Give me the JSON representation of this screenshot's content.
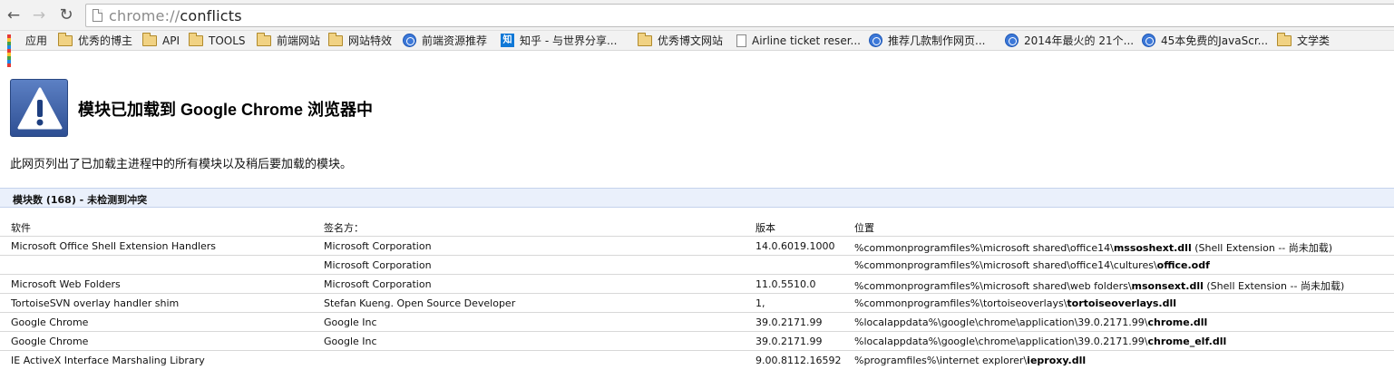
{
  "toolbar": {
    "back_glyph": "←",
    "forward_glyph": "→",
    "reload_glyph": "↻",
    "url_scheme": "chrome://",
    "url_host": "conflicts"
  },
  "bookmarks": [
    {
      "label": "应用",
      "icon": "apps-icon"
    },
    {
      "label": "优秀的博主",
      "icon": "folder-icon"
    },
    {
      "label": "API",
      "icon": "folder-icon"
    },
    {
      "label": "TOOLS",
      "icon": "folder-icon"
    },
    {
      "label": "前端网站",
      "icon": "folder-icon"
    },
    {
      "label": "网站特效",
      "icon": "folder-icon"
    },
    {
      "label": "前端资源推荐",
      "icon": "globe-icon"
    },
    {
      "label": "知乎 - 与世界分享...",
      "icon": "zhihu-icon",
      "glyph": "知"
    },
    {
      "label": "优秀博文网站",
      "icon": "folder-icon"
    },
    {
      "label": "Airline ticket reser...",
      "icon": "document-icon"
    },
    {
      "label": "推荐几款制作网页...",
      "icon": "globe-icon"
    },
    {
      "label": "2014年最火的 21个...",
      "icon": "globe-icon"
    },
    {
      "label": "45本免费的JavaScr...",
      "icon": "globe-icon"
    },
    {
      "label": "文学类",
      "icon": "folder-icon"
    }
  ],
  "page": {
    "title": "模块已加载到 Google Chrome 浏览器中",
    "intro": "此网页列出了已加载主进程中的所有模块以及稍后要加载的模块。",
    "summary": "模块数 (168) - 未检测到冲突"
  },
  "table": {
    "headers": [
      "软件",
      "签名方：",
      "版本",
      "位置"
    ],
    "rows": [
      {
        "software": "Microsoft Office Shell Extension Handlers",
        "signer": "Microsoft Corporation",
        "version": "14.0.6019.1000",
        "path": "%commonprogramfiles%\\microsoft shared\\office14\\",
        "file": "mssoshext.dll",
        "note": " (Shell Extension -- 尚未加载)"
      },
      {
        "software": "",
        "signer": "Microsoft Corporation",
        "version": "",
        "path": "%commonprogramfiles%\\microsoft shared\\office14\\cultures\\",
        "file": "office.odf",
        "note": ""
      },
      {
        "software": "Microsoft Web Folders",
        "signer": "Microsoft Corporation",
        "version": "11.0.5510.0",
        "path": "%commonprogramfiles%\\microsoft shared\\web folders\\",
        "file": "msonsext.dll",
        "note": " (Shell Extension -- 尚未加载)"
      },
      {
        "software": "TortoiseSVN overlay handler shim",
        "signer": "Stefan Kueng. Open Source Developer",
        "version": "1,",
        "path": "%commonprogramfiles%\\tortoiseoverlays\\",
        "file": "tortoiseoverlays.dll",
        "note": ""
      },
      {
        "software": "Google Chrome",
        "signer": "Google Inc",
        "version": "39.0.2171.99",
        "path": "%localappdata%\\google\\chrome\\application\\39.0.2171.99\\",
        "file": "chrome.dll",
        "note": ""
      },
      {
        "software": "Google Chrome",
        "signer": "Google Inc",
        "version": "39.0.2171.99",
        "path": "%localappdata%\\google\\chrome\\application\\39.0.2171.99\\",
        "file": "chrome_elf.dll",
        "note": ""
      },
      {
        "software": "IE ActiveX Interface Marshaling Library",
        "signer": "",
        "version": "9.00.8112.16592",
        "path": "%programfiles%\\internet explorer\\",
        "file": "ieproxy.dll",
        "note": ""
      }
    ]
  }
}
